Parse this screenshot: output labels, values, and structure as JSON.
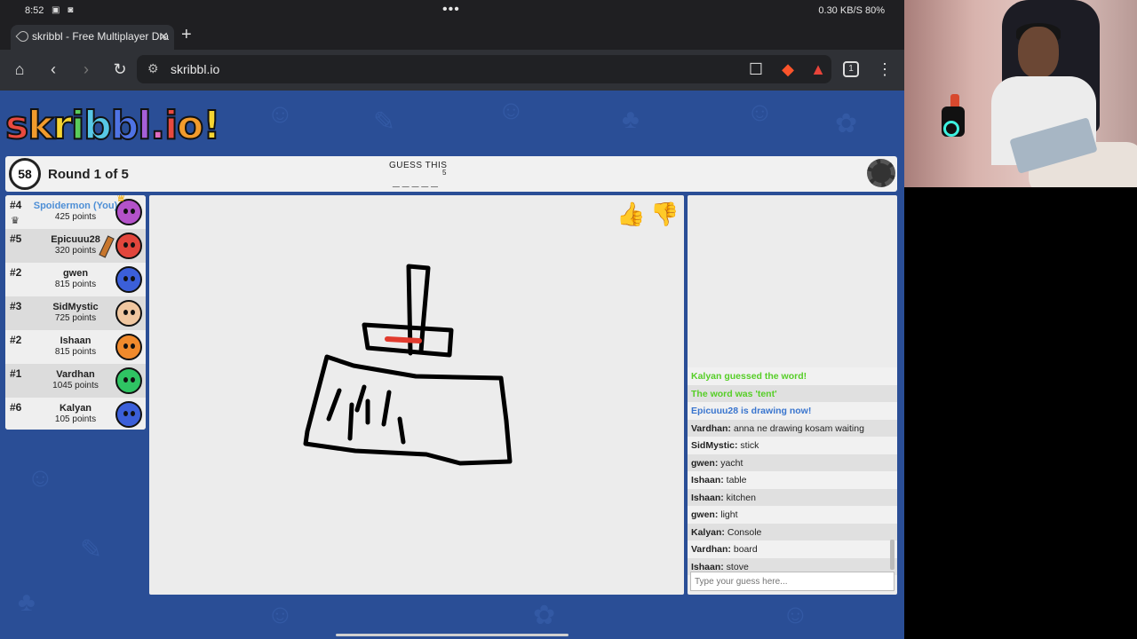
{
  "status_bar": {
    "time": "8:52",
    "right": "0.30 KB/S  80%"
  },
  "browser": {
    "tab_title": "skribbl - Free Multiplayer Dra",
    "url": "skribbl.io",
    "tabs_count": "1"
  },
  "game": {
    "logo_letters": [
      "s",
      "k",
      "r",
      "i",
      "b",
      "b",
      "l",
      ".",
      "i",
      "o",
      "!"
    ],
    "logo_colors": [
      "#e94a3f",
      "#f29b2c",
      "#f7d532",
      "#5acd5a",
      "#57c8e6",
      "#4f73e4",
      "#a65fd8",
      "#e16cc0",
      "#e94a3f",
      "#f29b2c",
      "#f7d532"
    ],
    "timer": "58",
    "round": "Round 1 of 5",
    "guess_label": "GUESS THIS",
    "guess_count": "5",
    "word_blanks": "_____"
  },
  "players": [
    {
      "rank": "#4",
      "name": "Spoidermon (You)",
      "points": "425 points",
      "avatar_color": "#b352c9",
      "you": true,
      "crown": true
    },
    {
      "rank": "#5",
      "name": "Epicuuu28",
      "points": "320 points",
      "avatar_color": "#e2463c",
      "drawing": true
    },
    {
      "rank": "#2",
      "name": "gwen",
      "points": "815 points",
      "avatar_color": "#3b5fd9"
    },
    {
      "rank": "#3",
      "name": "SidMystic",
      "points": "725 points",
      "avatar_color": "#f0c7a0"
    },
    {
      "rank": "#2",
      "name": "Ishaan",
      "points": "815 points",
      "avatar_color": "#f08a2c"
    },
    {
      "rank": "#1",
      "name": "Vardhan",
      "points": "1045 points",
      "avatar_color": "#2fc463"
    },
    {
      "rank": "#6",
      "name": "Kalyan",
      "points": "105 points",
      "avatar_color": "#3b5fd9"
    }
  ],
  "chat": {
    "messages": [
      {
        "type": "green",
        "text": "Kalyan guessed the word!"
      },
      {
        "type": "green",
        "text": "The word was 'tent'"
      },
      {
        "type": "blue",
        "text": "Epicuuu28 is drawing now!"
      },
      {
        "type": "user",
        "user": "Vardhan:",
        "text": " anna ne drawing kosam waiting"
      },
      {
        "type": "user",
        "user": "SidMystic:",
        "text": " stick"
      },
      {
        "type": "user",
        "user": "gwen:",
        "text": " yacht"
      },
      {
        "type": "user",
        "user": "Ishaan:",
        "text": " table"
      },
      {
        "type": "user",
        "user": "Ishaan:",
        "text": " kitchen"
      },
      {
        "type": "user",
        "user": "gwen:",
        "text": " light"
      },
      {
        "type": "user",
        "user": "Kalyan:",
        "text": " Console"
      },
      {
        "type": "user",
        "user": "Vardhan:",
        "text": " board"
      },
      {
        "type": "user",
        "user": "Ishaan:",
        "text": " stove"
      }
    ],
    "placeholder": "Type your guess here..."
  },
  "icons": {
    "thumb_up": "thumbs-up-icon",
    "thumb_down": "thumbs-down-icon",
    "settings": "gear-icon"
  }
}
